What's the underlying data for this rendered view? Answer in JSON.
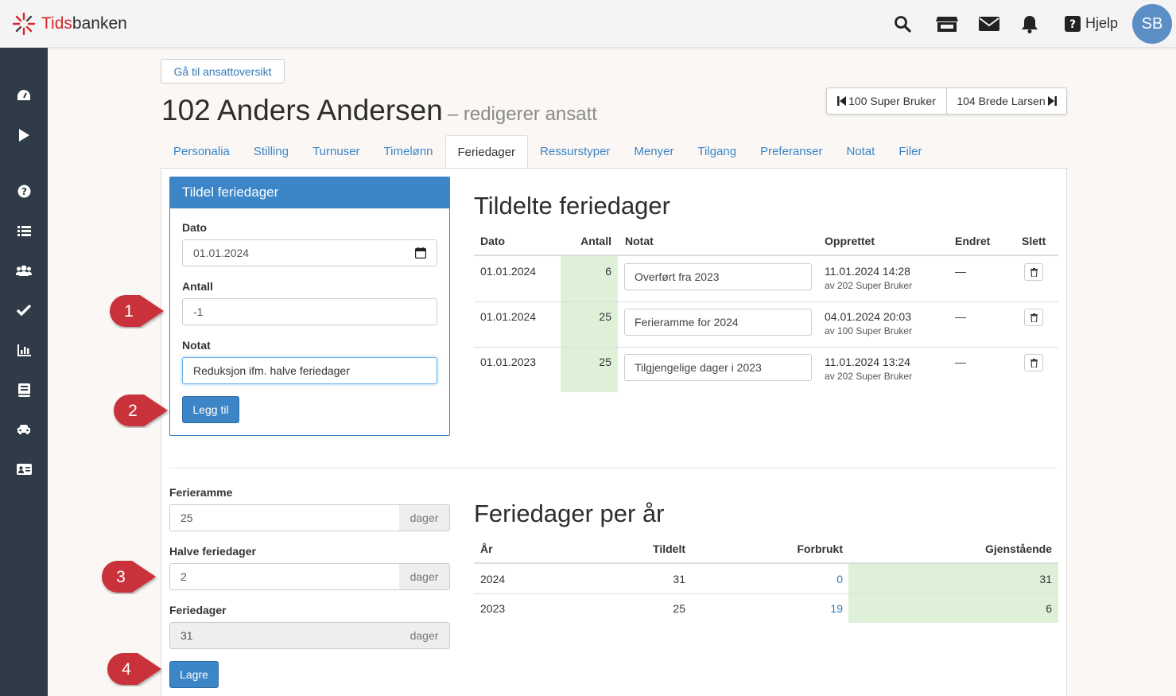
{
  "brand": {
    "name_part1": "Tids",
    "name_part2": "banken",
    "accent": "#d6262f"
  },
  "header": {
    "icons": [
      "search-icon",
      "store-icon",
      "mail-icon",
      "bell-icon",
      "question-icon"
    ],
    "help_label": "Hjelp",
    "avatar_initials": "SB"
  },
  "sidebar": {
    "icons": [
      "dashboard-icon",
      "play-icon",
      "help-circle-icon",
      "list-icon",
      "users-icon",
      "check-icon",
      "bar-chart-icon",
      "book-icon",
      "car-icon",
      "id-card-icon"
    ]
  },
  "back_button": "Gå til ansattoversikt",
  "title": {
    "main": "102 Anders Andersen",
    "sub": "– redigerer ansatt"
  },
  "nav": {
    "prev": "100 Super Bruker",
    "next": "104 Brede Larsen"
  },
  "tabs": [
    {
      "label": "Personalia"
    },
    {
      "label": "Stilling"
    },
    {
      "label": "Turnuser"
    },
    {
      "label": "Timelønn"
    },
    {
      "label": "Feriedager",
      "active": true
    },
    {
      "label": "Ressurstyper"
    },
    {
      "label": "Menyer"
    },
    {
      "label": "Tilgang"
    },
    {
      "label": "Preferanser"
    },
    {
      "label": "Notat"
    },
    {
      "label": "Filer"
    }
  ],
  "assign": {
    "heading": "Tildel feriedager",
    "date_label": "Dato",
    "date_value": "01.01.2024",
    "amount_label": "Antall",
    "amount_value": "-1",
    "note_label": "Notat",
    "note_value": "Reduksjon ifm. halve feriedager",
    "add_button": "Legg til"
  },
  "assigned": {
    "heading": "Tildelte feriedager",
    "columns": {
      "date": "Dato",
      "amount": "Antall",
      "note": "Notat",
      "created": "Opprettet",
      "changed": "Endret",
      "delete": "Slett"
    },
    "rows": [
      {
        "date": "01.01.2024",
        "amount": "6",
        "note": "Overført fra 2023",
        "created": "11.01.2024 14:28",
        "created_by": "av 202 Super Bruker",
        "changed": "—"
      },
      {
        "date": "01.01.2024",
        "amount": "25",
        "note": "Ferieramme for 2024",
        "created": "04.01.2024 20:03",
        "created_by": "av 100 Super Bruker",
        "changed": "—"
      },
      {
        "date": "01.01.2023",
        "amount": "25",
        "note": "Tilgjengelige dager i 2023",
        "created": "11.01.2024 13:24",
        "created_by": "av 202 Super Bruker",
        "changed": "—"
      }
    ]
  },
  "settings": {
    "frame_label": "Ferieramme",
    "frame_value": "25",
    "half_label": "Halve feriedager",
    "half_value": "2",
    "days_label": "Feriedager",
    "days_value": "31",
    "unit": "dager",
    "save_button": "Lagre"
  },
  "per_year": {
    "heading": "Feriedager per år",
    "columns": {
      "year": "År",
      "assigned": "Tildelt",
      "used": "Forbrukt",
      "remaining": "Gjenstående"
    },
    "rows": [
      {
        "year": "2024",
        "assigned": "31",
        "used": "0",
        "remaining": "31"
      },
      {
        "year": "2023",
        "assigned": "25",
        "used": "19",
        "remaining": "6"
      }
    ]
  },
  "callouts": [
    "1",
    "2",
    "3",
    "4"
  ]
}
